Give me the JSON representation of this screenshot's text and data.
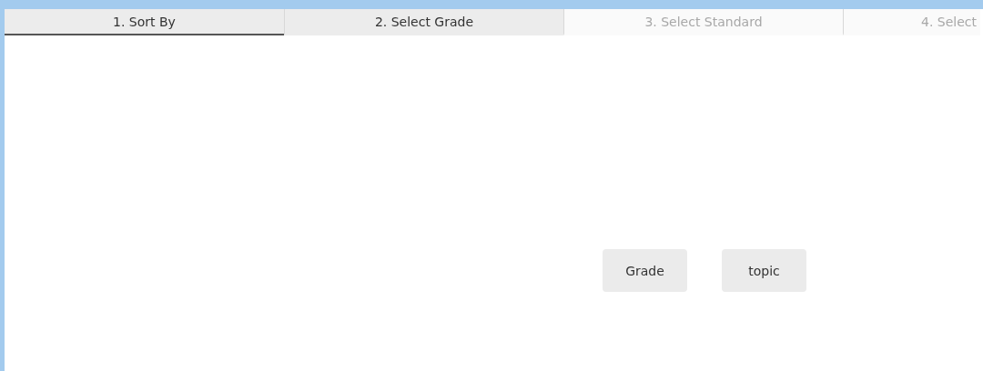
{
  "tabs": [
    {
      "label": "1. Sort By",
      "selected": true,
      "disabled": false
    },
    {
      "label": "2. Select Grade",
      "selected": false,
      "disabled": false
    },
    {
      "label": "3. Select Standard",
      "selected": false,
      "disabled": true
    },
    {
      "label": "4. Select",
      "selected": false,
      "disabled": true
    }
  ],
  "sort_options": [
    {
      "label": "Grade"
    },
    {
      "label": "topic"
    }
  ]
}
